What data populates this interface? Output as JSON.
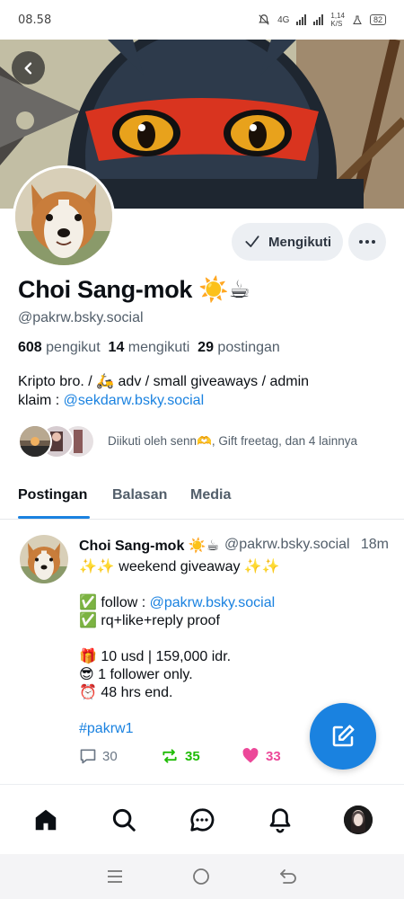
{
  "status_bar": {
    "time": "08.58",
    "network": "4G",
    "speed": "1,14",
    "speed_unit": "K/S",
    "battery": "82"
  },
  "profile": {
    "display_name": "Choi Sang-mok ☀️☕",
    "handle": "@pakrw.bsky.social",
    "follow_button_label": "Mengikuti",
    "followers_count": "608",
    "followers_label": "pengikut",
    "following_count": "14",
    "following_label": "mengikuti",
    "posts_count": "29",
    "posts_label": "postingan",
    "bio_line1": "Kripto bro. / 🛵 adv / small giveaways / admin",
    "bio_line2_prefix": "klaim : ",
    "bio_link": "@sekdarw.bsky.social",
    "followed_by": "Diikuti oleh senn🫶, Gift freetag, dan 4 lainnya"
  },
  "tabs": [
    {
      "label": "Postingan",
      "active": true
    },
    {
      "label": "Balasan",
      "active": false
    },
    {
      "label": "Media",
      "active": false
    }
  ],
  "post": {
    "author_name": "Choi Sang-mok ☀️☕",
    "author_handle": "@pakrw.bsky.social",
    "time": "18m",
    "lines": [
      "✨✨ weekend giveaway ✨✨",
      "",
      "✅ follow : ",
      "✅ rq+like+reply proof",
      "",
      "🎁 10 usd | 159,000 idr.",
      "😎 1 follower only.",
      "⏰ 48 hrs end.",
      "",
      "#pakrw1"
    ],
    "follow_link": "@pakrw.bsky.social",
    "hashtag": "#pakrw1",
    "replies": "30",
    "reposts": "35",
    "likes": "33"
  },
  "colors": {
    "accent": "#1a82e0",
    "repost": "#20bc07",
    "like": "#ec4899",
    "muted": "#525e6a"
  },
  "nav": [
    "home-icon",
    "search-icon",
    "chat-icon",
    "bell-icon",
    "profile-avatar"
  ],
  "system_nav": [
    "recent-apps-icon",
    "home-circle-icon",
    "back-icon"
  ]
}
